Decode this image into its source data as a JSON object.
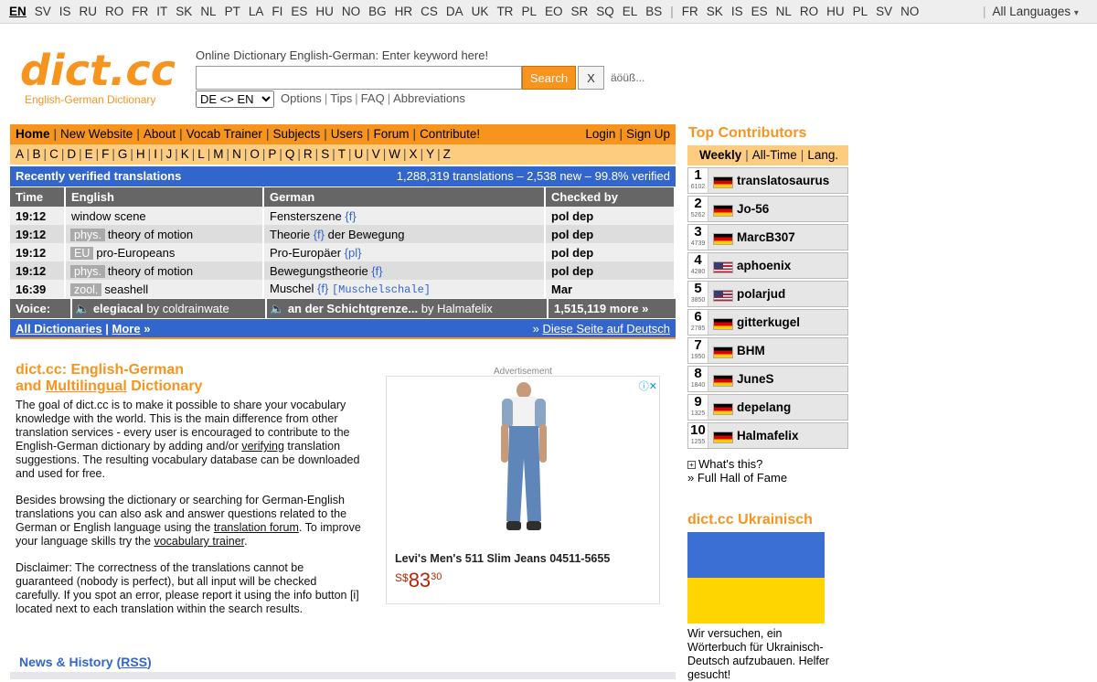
{
  "colors": {
    "accent": "#f7941e",
    "light_accent": "#fecc7f",
    "blue": "#3366cc",
    "gray_header": "#666666"
  },
  "top_languages": {
    "active": "EN",
    "left": [
      "EN",
      "SV",
      "IS",
      "RU",
      "RO",
      "FR",
      "IT",
      "SK",
      "NL",
      "PT",
      "LA",
      "FI",
      "ES",
      "HU",
      "NO",
      "BG",
      "HR",
      "CS",
      "DA",
      "UK",
      "TR",
      "PL",
      "EO",
      "SR",
      "SQ",
      "EL",
      "BS"
    ],
    "right": [
      "FR",
      "SK",
      "IS",
      "ES",
      "NL",
      "RO",
      "HU",
      "PL",
      "SV",
      "NO"
    ],
    "all_languages": "All Languages",
    "dropdown_icon": "chevron-down-icon"
  },
  "logo": {
    "main": "dict.cc",
    "sub": "English-German Dictionary"
  },
  "search": {
    "label": "Online Dictionary English-German: Enter keyword here!",
    "value": "",
    "button": "Search",
    "clear": "X",
    "special_chars": "äöüß...",
    "direction": "DE <> EN",
    "links": [
      "Options",
      "Tips",
      "FAQ",
      "Abbreviations"
    ]
  },
  "nav": {
    "left": [
      "Home",
      "New Website",
      "About",
      "Vocab Trainer",
      "Subjects",
      "Users",
      "Forum",
      "Contribute!"
    ],
    "right": [
      "Login",
      "Sign Up"
    ]
  },
  "alphabet": [
    "A",
    "B",
    "C",
    "D",
    "E",
    "F",
    "G",
    "H",
    "I",
    "J",
    "K",
    "L",
    "M",
    "N",
    "O",
    "P",
    "Q",
    "R",
    "S",
    "T",
    "U",
    "V",
    "W",
    "X",
    "Y",
    "Z"
  ],
  "recent": {
    "title": "Recently verified translations",
    "stats": "1,288,319 translations – 2,538 new – 99.8% verified",
    "headers": [
      "Time",
      "English",
      "German",
      "Checked by"
    ],
    "rows": [
      {
        "time": "19:12",
        "subj": "",
        "en": "window scene",
        "de": "Fensterszene",
        "gram": "{f}",
        "de_after": "",
        "extra": "",
        "checker": "pol dep"
      },
      {
        "time": "19:12",
        "subj": "phys.",
        "en": "theory of motion",
        "de": "Theorie",
        "gram": "{f}",
        "de_after": "der Bewegung",
        "extra": "",
        "checker": "pol dep"
      },
      {
        "time": "19:12",
        "subj": "EU",
        "en": "pro-Europeans",
        "de": "Pro-Europäer",
        "gram": "{pl}",
        "de_after": "",
        "extra": "",
        "checker": "pol dep"
      },
      {
        "time": "19:12",
        "subj": "phys.",
        "en": "theory of motion",
        "de": "Bewegungstheorie",
        "gram": "{f}",
        "de_after": "",
        "extra": "",
        "checker": "pol dep"
      },
      {
        "time": "16:39",
        "subj": "zool.",
        "en": "seashell",
        "de": "Muschel",
        "gram": "{f}",
        "de_after": "",
        "extra": "[Muschelschale]",
        "checker": "Mar"
      }
    ]
  },
  "voice": {
    "label": "Voice:",
    "en_word": "elegiacal",
    "en_by": "by coldrainwate",
    "de_word": "an der Schichtgrenze...",
    "de_by": "by Halmafelix",
    "more": "1,515,119 more »",
    "speaker_icon": "speaker-icon"
  },
  "all_dict": {
    "all": "All Dictionaries",
    "more": "More",
    "raquo": "»",
    "german_prefix": "»",
    "german": "Diese Seite auf Deutsch"
  },
  "intro": {
    "title_1": "dict.cc: English-German",
    "title_2a": "and ",
    "title_2b": "Multilingual",
    "title_2c": " Dictionary",
    "p1_a": "The goal of dict.cc is to make it possible to share your vocabulary knowledge with the world. This is the main difference from other translation services - every user is encouraged to contribute to the English-German dictionary by adding and/or ",
    "p1_link": "verifying",
    "p1_b": " translation suggestions. The resulting vocabulary database can be downloaded and used for free.",
    "p2_a": "Besides browsing the dictionary or searching for German-English translations you can also ask and answer questions related to the German or English language using the ",
    "p2_link1": "translation forum",
    "p2_b": ". To improve your language skills try the ",
    "p2_link2": "vocabulary trainer",
    "p2_c": ".",
    "p3": "Disclaimer: The correctness of the translations cannot be guaranteed (nobody is perfect), but all input will be checked carefully. If you spot an error, please report it using the info button [i] located next to each translation within the search results."
  },
  "news": {
    "title_a": "News & History (",
    "rss": "RSS",
    "title_b": ")"
  },
  "ad": {
    "label": "Advertisement",
    "product": "Levi's Men's 511 Slim Jeans 04511-5655",
    "currency": "S$",
    "price_whole": "83",
    "price_cents": "30",
    "close_icon": "ad-choices-close-icon"
  },
  "top_contributors": {
    "title": "Top Contributors",
    "tabs": [
      "Weekly",
      "All-Time",
      "Lang."
    ],
    "active_tab": "Weekly",
    "list": [
      {
        "rank": "1",
        "score": "6102",
        "name": "translatosaurus",
        "flag": "de"
      },
      {
        "rank": "2",
        "score": "5262",
        "name": "Jo-56",
        "flag": "de"
      },
      {
        "rank": "3",
        "score": "4739",
        "name": "MarcB307",
        "flag": "de"
      },
      {
        "rank": "4",
        "score": "4280",
        "name": "aphoenix",
        "flag": "us"
      },
      {
        "rank": "5",
        "score": "3850",
        "name": "polarjud",
        "flag": "us"
      },
      {
        "rank": "6",
        "score": "2785",
        "name": "gitterkugel",
        "flag": "de"
      },
      {
        "rank": "7",
        "score": "1950",
        "name": "BHM",
        "flag": "de"
      },
      {
        "rank": "8",
        "score": "1840",
        "name": "JuneS",
        "flag": "de"
      },
      {
        "rank": "9",
        "score": "1325",
        "name": "depelang",
        "flag": "de"
      },
      {
        "rank": "10",
        "score": "1255",
        "name": "Halmafelix",
        "flag": "de"
      }
    ],
    "whats_this": "What's this?",
    "hall_of_fame": "» Full Hall of Fame"
  },
  "ukraine": {
    "title": "dict.cc Ukrainisch",
    "text": "Wir versuchen, ein Wörterbuch für Ukrainisch-Deutsch aufzubauen. Helfer gesucht!"
  }
}
